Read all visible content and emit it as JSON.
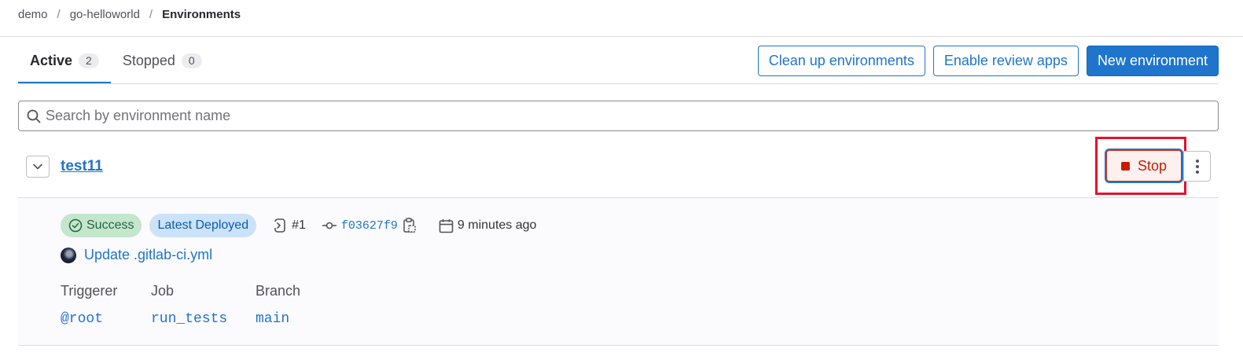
{
  "breadcrumb": {
    "items": [
      "demo",
      "go-helloworld"
    ],
    "current": "Environments",
    "separator": "/"
  },
  "tabs": [
    {
      "label": "Active",
      "count": "2",
      "active": true
    },
    {
      "label": "Stopped",
      "count": "0",
      "active": false
    }
  ],
  "actions": {
    "cleanup_label": "Clean up environments",
    "review_apps_label": "Enable review apps",
    "new_env_label": "New environment"
  },
  "search": {
    "placeholder": "Search by environment name",
    "value": ""
  },
  "environment": {
    "name": "test11",
    "stop_label": "Stop",
    "status": "Success",
    "deployment_badge": "Latest Deployed",
    "pipeline": "#1",
    "commit_sha": "f03627f9",
    "time_ago": "9 minutes ago",
    "commit_title": "Update .gitlab-ci.yml",
    "details": {
      "triggerer_label": "Triggerer",
      "triggerer_value": "@root",
      "job_label": "Job",
      "job_value": "run_tests",
      "branch_label": "Branch",
      "branch_value": "main"
    }
  },
  "colors": {
    "accent": "#1f75cb",
    "danger": "#dd2b0e",
    "success_bg": "#c3e6cd",
    "highlight": "#e8102c"
  }
}
